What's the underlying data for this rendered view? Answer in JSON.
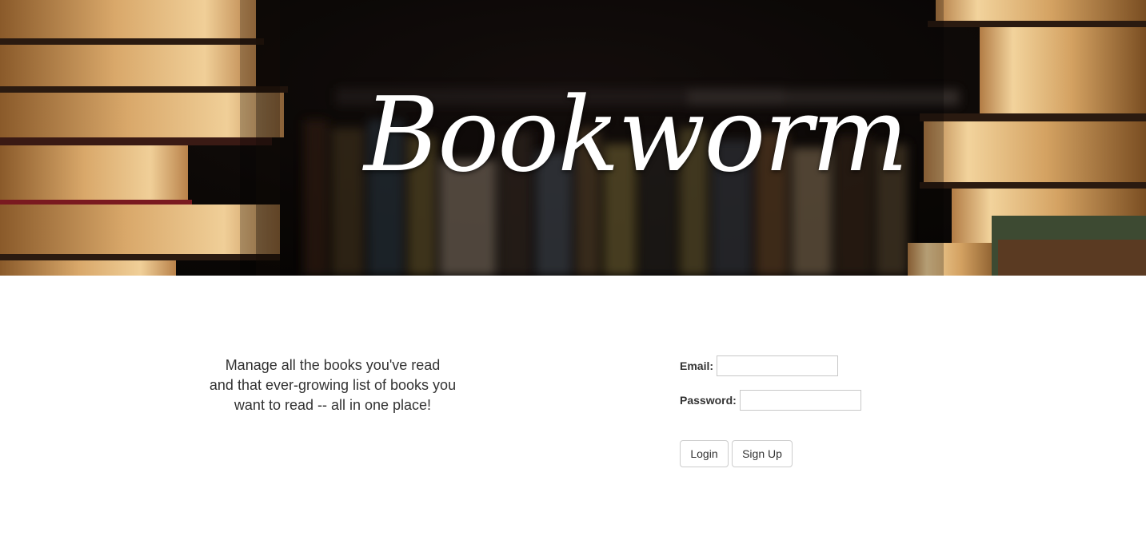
{
  "hero": {
    "title": "Bookworm"
  },
  "intro": {
    "lines": [
      "Manage all the books you've read",
      "and that ever-growing list of books you",
      "want to read -- all in one place!"
    ]
  },
  "login_form": {
    "email_label": "Email:",
    "email_value": "",
    "password_label": "Password:",
    "password_value": "",
    "login_button": "Login",
    "signup_button": "Sign Up"
  },
  "colors": {
    "text": "#333333",
    "input_border": "#c8c8c8",
    "button_border": "#cccccc",
    "hero_title": "#ffffff"
  }
}
